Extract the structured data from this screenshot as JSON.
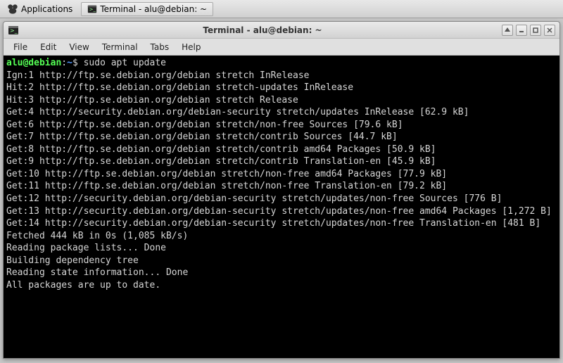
{
  "taskbar": {
    "applications_label": "Applications",
    "task_label": "Terminal - alu@debian: ~"
  },
  "window": {
    "title": "Terminal - alu@debian: ~"
  },
  "menubar": {
    "file": "File",
    "edit": "Edit",
    "view": "View",
    "terminal": "Terminal",
    "tabs": "Tabs",
    "help": "Help"
  },
  "prompt": {
    "user_host": "alu@debian",
    "colon": ":",
    "path": "~",
    "symbol": "$"
  },
  "command": "sudo apt update",
  "output_lines": [
    "Ign:1 http://ftp.se.debian.org/debian stretch InRelease",
    "Hit:2 http://ftp.se.debian.org/debian stretch-updates InRelease",
    "Hit:3 http://ftp.se.debian.org/debian stretch Release",
    "Get:4 http://security.debian.org/debian-security stretch/updates InRelease [62.9 kB]",
    "Get:6 http://ftp.se.debian.org/debian stretch/non-free Sources [79.6 kB]",
    "Get:7 http://ftp.se.debian.org/debian stretch/contrib Sources [44.7 kB]",
    "Get:8 http://ftp.se.debian.org/debian stretch/contrib amd64 Packages [50.9 kB]",
    "Get:9 http://ftp.se.debian.org/debian stretch/contrib Translation-en [45.9 kB]",
    "Get:10 http://ftp.se.debian.org/debian stretch/non-free amd64 Packages [77.9 kB]",
    "Get:11 http://ftp.se.debian.org/debian stretch/non-free Translation-en [79.2 kB]",
    "Get:12 http://security.debian.org/debian-security stretch/updates/non-free Sources [776 B]",
    "Get:13 http://security.debian.org/debian-security stretch/updates/non-free amd64 Packages [1,272 B]",
    "Get:14 http://security.debian.org/debian-security stretch/updates/non-free Translation-en [481 B]",
    "Fetched 444 kB in 0s (1,085 kB/s)",
    "Reading package lists... Done",
    "Building dependency tree",
    "Reading state information... Done",
    "All packages are up to date."
  ]
}
